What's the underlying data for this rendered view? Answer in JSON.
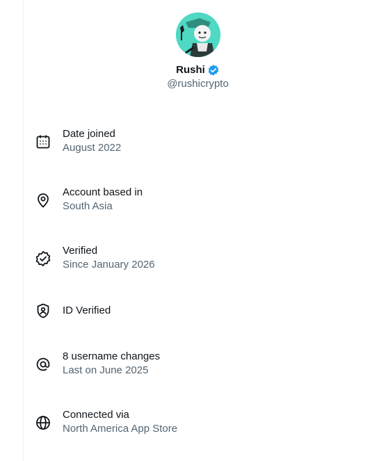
{
  "profile": {
    "name": "Rushi",
    "handle": "@rushicrypto",
    "avatar_bg": "#4fd8c4",
    "verified_color": "#1d9bf0"
  },
  "info": [
    {
      "icon": "calendar-icon",
      "title": "Date joined",
      "sub": "August 2022"
    },
    {
      "icon": "location-pin-icon",
      "title": "Account based in",
      "sub": "South Asia"
    },
    {
      "icon": "verified-badge-icon",
      "title": "Verified",
      "sub": "Since January 2026"
    },
    {
      "icon": "id-shield-icon",
      "title": "ID Verified",
      "sub": ""
    },
    {
      "icon": "at-sign-icon",
      "title": "8 username changes",
      "sub": "Last on June 2025"
    },
    {
      "icon": "globe-icon",
      "title": "Connected via",
      "sub": "North America App Store"
    }
  ]
}
